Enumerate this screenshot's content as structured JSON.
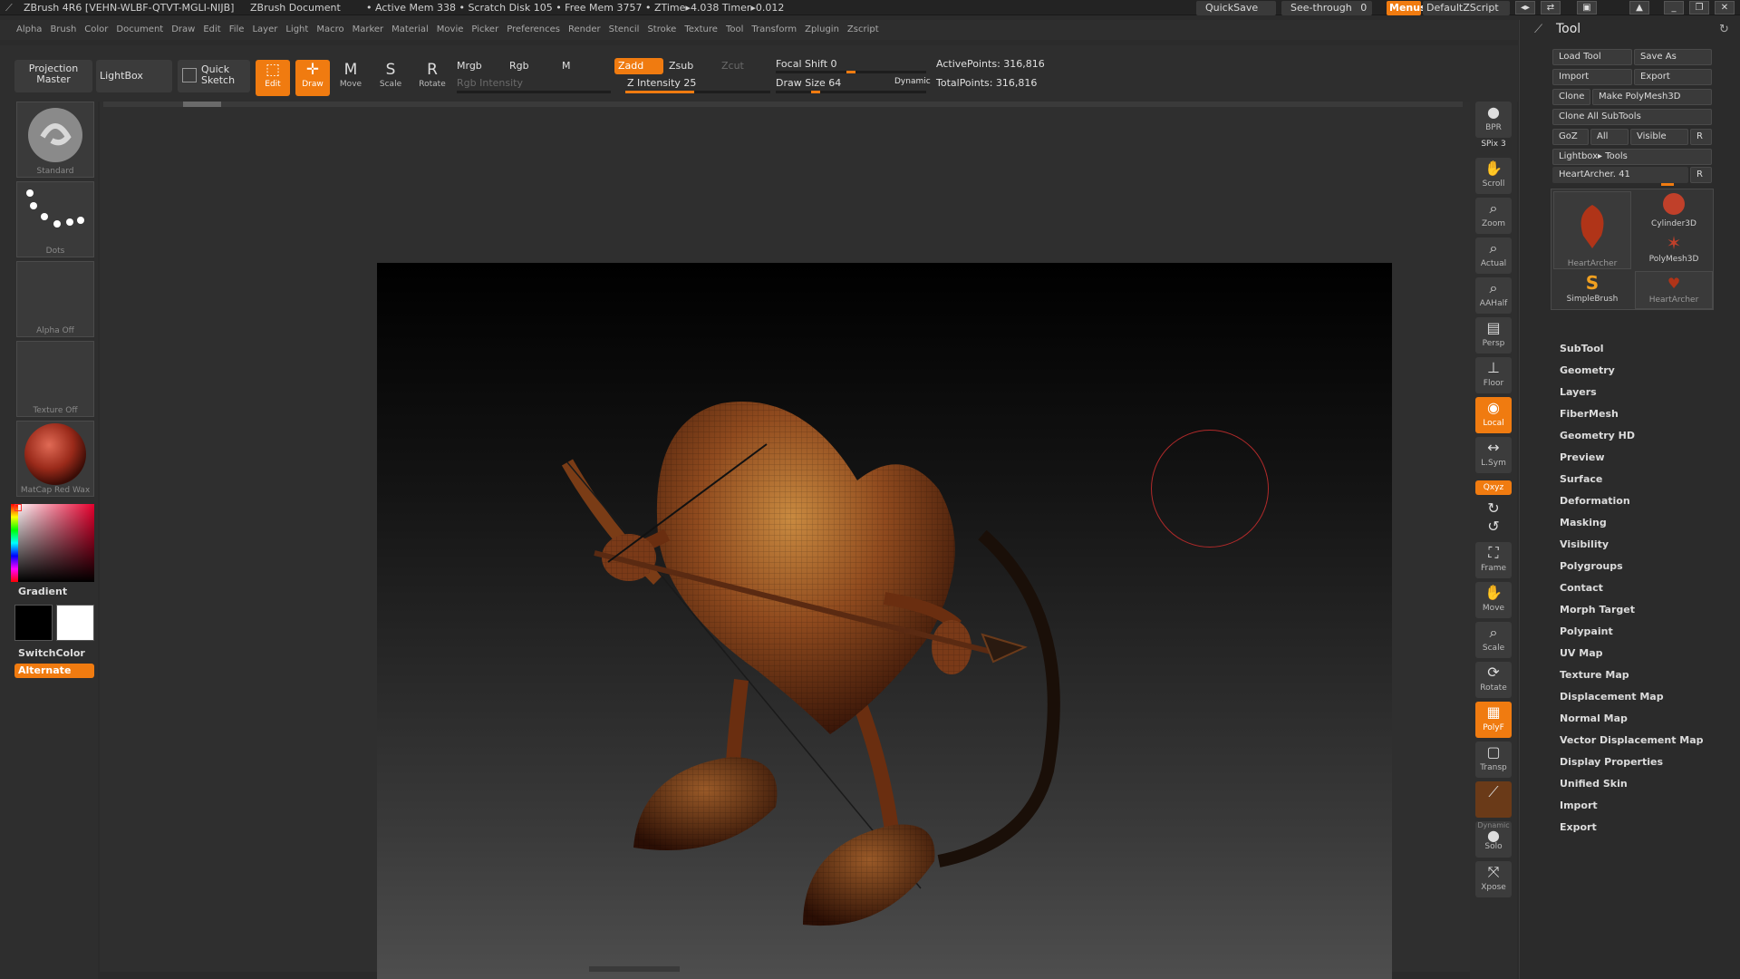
{
  "titlebar": {
    "app": "ZBrush 4R6 [VEHN-WLBF-QTVT-MGLI-NIJB]",
    "document": "ZBrush Document",
    "stats": "• Active Mem 338 • Scratch Disk 105 • Free Mem 3757 • ZTime▸4.038 Timer▸0.012",
    "quicksave": "QuickSave",
    "seethrough": "See-through",
    "seethrough_value": "0",
    "menus": "Menus",
    "script": "DefaultZScript"
  },
  "menubar": [
    "Alpha",
    "Brush",
    "Color",
    "Document",
    "Draw",
    "Edit",
    "File",
    "Layer",
    "Light",
    "Macro",
    "Marker",
    "Material",
    "Movie",
    "Picker",
    "Preferences",
    "Render",
    "Stencil",
    "Stroke",
    "Texture",
    "Tool",
    "Transform",
    "Zplugin",
    "Zscript"
  ],
  "shelf": {
    "projection_master": "Projection Master",
    "lightbox": "LightBox",
    "quick_sketch": "Quick Sketch",
    "edit": "Edit",
    "draw": "Draw",
    "move": "Move",
    "scale": "Scale",
    "rotate": "Rotate",
    "mrgb": "Mrgb",
    "rgb": "Rgb",
    "m": "M",
    "rgb_intensity": "Rgb Intensity",
    "zadd": "Zadd",
    "zsub": "Zsub",
    "zcut": "Zcut",
    "z_intensity": "Z Intensity 25",
    "focal_shift": "Focal Shift 0",
    "draw_size": "Draw Size 64",
    "dynamic": "Dynamic",
    "active_points": "ActivePoints: 316,816",
    "total_points": "TotalPoints: 316,816"
  },
  "lefttray": {
    "brush": "Standard",
    "stroke": "Dots",
    "alpha": "Alpha Off",
    "texture": "Texture Off",
    "material": "MatCap Red Wax",
    "gradient": "Gradient",
    "switchcolor": "SwitchColor",
    "alternate": "Alternate"
  },
  "viewtray": {
    "bpr": "BPR",
    "spix": "SPix 3",
    "scroll": "Scroll",
    "zoom": "Zoom",
    "actual": "Actual",
    "aahalf": "AAHalf",
    "persp": "Persp",
    "floor": "Floor",
    "local": "Local",
    "lsym": "L.Sym",
    "xyz": "Qxyz",
    "frame": "Frame",
    "move": "Move",
    "scale": "Scale",
    "rotate": "Rotate",
    "polyf": "PolyF",
    "transp": "Transp",
    "dynamic": "Dynamic",
    "solo": "Solo",
    "xpose": "Xpose"
  },
  "tool": {
    "title": "Tool",
    "load_tool": "Load Tool",
    "save_as": "Save As",
    "import": "Import",
    "export": "Export",
    "clone": "Clone",
    "make_polymesh": "Make PolyMesh3D",
    "clone_all": "Clone All SubTools",
    "goz": "GoZ",
    "all": "All",
    "visible": "Visible",
    "r": "R",
    "lightbox_tools": "Lightbox▸ Tools",
    "current_tool": "HeartArcher. 41",
    "thumbs": [
      "HeartArcher",
      "Cylinder3D",
      "PolyMesh3D",
      "SimpleBrush",
      "HeartArcher"
    ],
    "sections": [
      "SubTool",
      "Geometry",
      "Layers",
      "FiberMesh",
      "Geometry HD",
      "Preview",
      "Surface",
      "Deformation",
      "Masking",
      "Visibility",
      "Polygroups",
      "Contact",
      "Morph Target",
      "Polypaint",
      "UV Map",
      "Texture Map",
      "Displacement Map",
      "Normal Map",
      "Vector Displacement Map",
      "Display Properties",
      "Unified Skin",
      "Import",
      "Export"
    ]
  },
  "colors": {
    "accent": "#f07b10",
    "panel": "#2e2e2e",
    "button": "#3a3a3a"
  }
}
